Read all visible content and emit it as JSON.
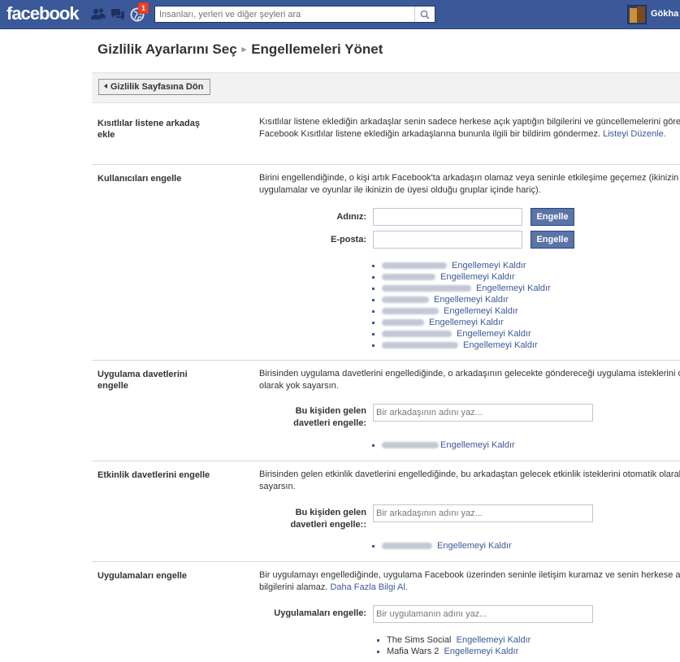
{
  "topbar": {
    "logo": "facebook",
    "notification_count": "1",
    "search_placeholder": "İnsanları, yerleri ve diğer şeyleri ara",
    "username": "Gökha"
  },
  "breadcrumb": {
    "parent": "Gizlilik Ayarlarını Seç",
    "separator": "▸",
    "current": "Engellemeleri Yönet"
  },
  "back_button": "Gizlilik Sayfasına Dön",
  "restricted": {
    "title": "Kısıtlılar listene arkadaş ekle",
    "desc_line1": "Kısıtlılar listene eklediğin arkadaşlar senin sadece herkese açık yaptığın bilgilerini ve güncellemelerini görebilir.",
    "desc_line2": "Facebook Kısıtlılar listene eklediğin arkadaşlarına bununla ilgili bir bildirim göndermez.",
    "link": "Listeyi Düzenle."
  },
  "block_users": {
    "title": "Kullanıcıları engelle",
    "desc_line1": "Birini engellendiğinde, o kişi artık Facebook'ta arkadaşın olamaz veya seninle etkileşime geçemez (ikinizin de ku",
    "desc_line2": "uygulamalar ve oyunlar ile ikinizin de üyesi olduğu gruplar içinde hariç).",
    "name_label": "Adınız:",
    "email_label": "E-posta:",
    "button_label": "Engelle",
    "unblock_label": "Engellemeyi Kaldır",
    "blocked_count": 8
  },
  "app_invites": {
    "title": "Uygulama davetlerini engelle",
    "desc_line1": "Birisinden uygulama davetlerini engellediğinde, o arkadaşının gelecekte göndereceği uygulama isteklerini otom",
    "desc_line2": "olarak yok sayarsın.",
    "field_label_1": "Bu kişiden gelen",
    "field_label_2": "davetleri engelle:",
    "placeholder": "Bir arkadaşının adını yaz...",
    "unblock_label": "Engellemeyi Kaldır"
  },
  "event_invites": {
    "title": "Etkinlik davetlerini engelle",
    "desc_line1": "Birisinden gelen etkinlik davetlerini engellediğinde, bu arkadaştan gelecek etkinlik isteklerini otomatik olarak yo",
    "desc_line2": "sayarsın.",
    "field_label_1": "Bu kişiden gelen",
    "field_label_2": "davetleri engelle::",
    "placeholder": "Bir arkadaşının adını yaz...",
    "unblock_label": "Engellemeyi Kaldır"
  },
  "block_apps": {
    "title": "Uygulamaları engelle",
    "desc_line1": "Bir uygulamayı engellediğinde, uygulama Facebook üzerinden seninle iletişim kuramaz ve senin herkese açık o",
    "desc_line2": "bilgilerini alamaz.",
    "link": "Daha Fazla Bilgi Al.",
    "field_label": "Uygulamaları engelle:",
    "placeholder": "Bir uygulamanın adını yaz...",
    "apps": [
      {
        "name": "The Sims Social",
        "action": "Engellemeyi Kaldır"
      },
      {
        "name": "Mafia Wars 2",
        "action": "Engellemeyi Kaldır"
      }
    ]
  },
  "colors": {
    "topbar": "#3b5998",
    "link": "#3b5998",
    "button": "#5b74a8"
  }
}
